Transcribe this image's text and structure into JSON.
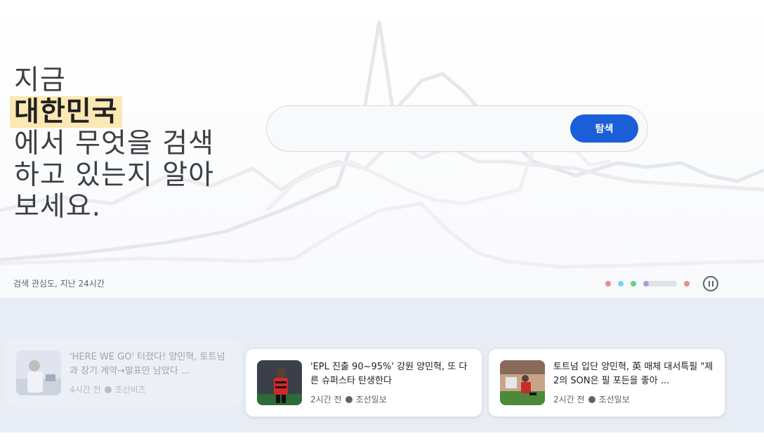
{
  "hero": {
    "headline": {
      "line1": "지금",
      "region": "대한민국",
      "line3": "에서 무엇을 검색",
      "line4": "하고 있는지 알아",
      "line5": "보세요."
    },
    "search": {
      "value": "",
      "placeholder": "",
      "button_label": "탐색"
    },
    "caption": "검색 관심도, 지난 24시간",
    "carousel": {
      "dot_colors": [
        "#e88c8c",
        "#7ccff5",
        "#6ccf8a",
        "#a99ae0",
        "#e88c8c"
      ],
      "active_index": 3,
      "active_progress": 0.15
    },
    "pause_icon": "pause-circle-icon"
  },
  "news": {
    "cards": [
      {
        "title": "'HERE WE GO' 터졌다! 양민혁, 토트넘과 장기 계약→발표만 남았다 ...",
        "time": "4시간 전",
        "source": "조선비즈",
        "faded": true
      },
      {
        "title": "'EPL 진출 90~95%' 강원 양민혁, 또 다른 슈퍼스타 탄생한다",
        "time": "2시간 전",
        "source": "조선일보",
        "faded": false
      },
      {
        "title": "토트넘 입단 양민혁, 英 매체 대서특필 \"제2의 SON은 필 포든을 좋아 ...",
        "time": "2시간 전",
        "source": "조선일보",
        "faded": false
      }
    ]
  },
  "colors": {
    "accent": "#1a5fd8",
    "highlight": "#fce8b2",
    "news_bg": "#e8ecf4"
  }
}
